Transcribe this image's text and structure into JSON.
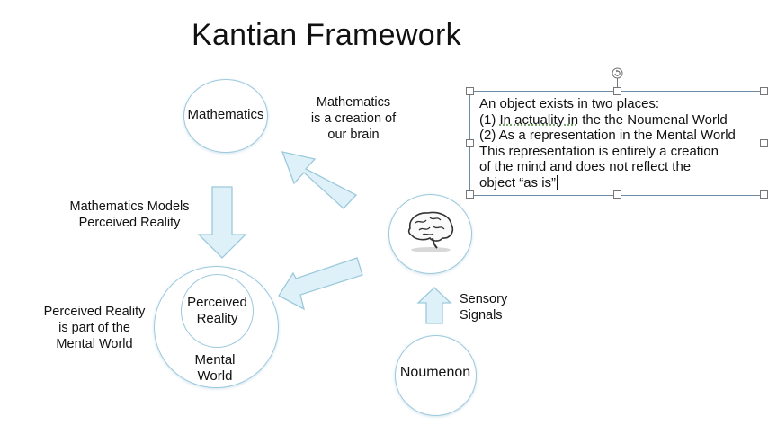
{
  "title": "Kantian Framework",
  "nodes": {
    "mathematics": "Mathematics",
    "perceived_reality": [
      "Perceived",
      "Reality"
    ],
    "mental_world": [
      "Mental",
      "World"
    ],
    "noumenon": "Noumenon"
  },
  "labels": {
    "math_creation": [
      "Mathematics",
      "is a creation of",
      "our brain"
    ],
    "math_models": [
      "Mathematics Models",
      "Perceived Reality"
    ],
    "perceived_part": [
      "Perceived Reality",
      "is part of the",
      "Mental World"
    ],
    "sensory": [
      "Sensory",
      "Signals"
    ]
  },
  "textbox": {
    "line1": "An object exists in two places:",
    "line2_prefix": "(1) ",
    "line2_underlined": "In actuality in",
    "line2_suffix": " the the Noumenal World",
    "line3": "(2) As a representation in the Mental World",
    "line4": "This representation is entirely a creation",
    "line5": "of the mind and does not reflect the",
    "line6": "object “as is”"
  },
  "icons": {
    "brain": "brain-icon",
    "rotate_handle": "rotate-handle-icon"
  },
  "colors": {
    "arrow_fill": "#dff1f8",
    "arrow_stroke": "#9cc9dc",
    "circle_stroke": "#9cc9dc"
  }
}
